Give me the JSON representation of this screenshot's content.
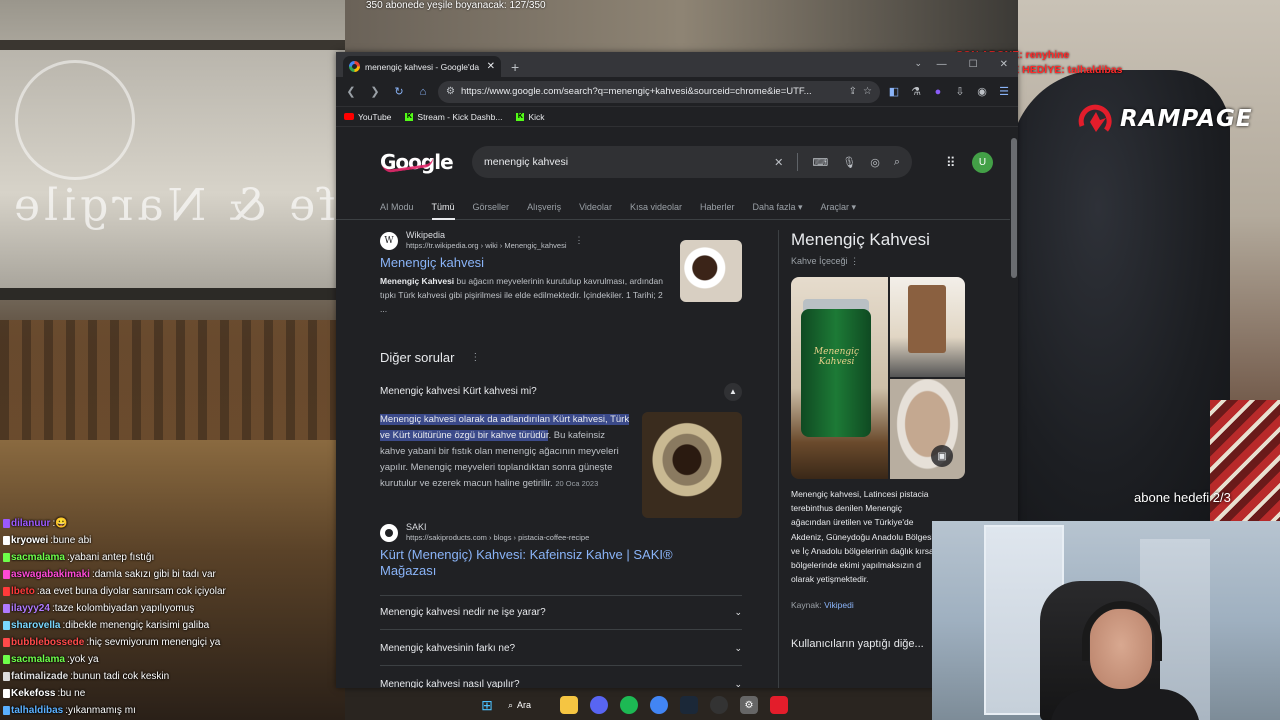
{
  "stream": {
    "sub_goal": "350 abonede yeşile boyanacak: 127/350",
    "last_sub_line1": "SON ABONE: renyhine",
    "last_sub_line2": "SON ABONE HEDİYE: talhaldibas",
    "sponsor": "RAMPAGE",
    "abone_goal": "abone hedefi 2/3"
  },
  "chat": [
    {
      "user": "dilanuur",
      "msg": "😀",
      "color": "#9b59ff"
    },
    {
      "user": "kryowei",
      "msg": "bune abi",
      "color": "#ffffff"
    },
    {
      "user": "sacmalama",
      "msg": "yabani antep fıstığı",
      "color": "#6eff4a"
    },
    {
      "user": "aswagabakimaki",
      "msg": "damla sakızı gibi bi tadı var",
      "color": "#ff4ad6"
    },
    {
      "user": "lbeto",
      "msg": "aa evet buna diyolar sanırsam cok içiyolar",
      "color": "#ff3a3a"
    },
    {
      "user": "ilayyy24",
      "msg": "taze kolombiyadan yapılıyomuş",
      "color": "#b07aff"
    },
    {
      "user": "sharovella",
      "msg": "dibekle menengiç karisimi galiba",
      "color": "#7ad8ff"
    },
    {
      "user": "bubblebossede",
      "msg": "hiç sevmiyorum menengiçi ya",
      "color": "#ff4a4a"
    },
    {
      "user": "sacmalama",
      "msg": "yok ya",
      "color": "#6eff4a"
    },
    {
      "user": "fatimalizade",
      "msg": "bunun tadi cok keskin",
      "color": "#dddddd"
    },
    {
      "user": "Kekefoss",
      "msg": "bu ne",
      "color": "#ffffff"
    },
    {
      "user": "talhaldibas",
      "msg": "yıkanmamış mı",
      "color": "#5ab0ff"
    }
  ],
  "browser": {
    "tab_title": "menengiç kahvesi - Google'da",
    "url": "https://www.google.com/search?q=menengiç+kahvesi&sourceid=chrome&ie=UTF...",
    "bookmarks": [
      {
        "label": "YouTube"
      },
      {
        "label": "Stream - Kick Dashb..."
      },
      {
        "label": "Kick"
      }
    ]
  },
  "google": {
    "logo": "Google",
    "query": "menengiç kahvesi",
    "tabs": [
      "AI Modu",
      "Tümü",
      "Görseller",
      "Alışveriş",
      "Videolar",
      "Kısa videolar",
      "Haberler",
      "Daha fazla ▾",
      "Araçlar ▾"
    ],
    "active_tab": "Tümü",
    "result1": {
      "site": "Wikipedia",
      "url": "https://tr.wikipedia.org › wiki › Menengiç_kahvesi",
      "title": "Menengiç kahvesi",
      "snippet_bold": "Menengiç Kahvesi",
      "snippet": " bu ağacın meyvelerinin kurutulup kavrulması, ardından tıpkı Türk kahvesi gibi pişirilmesi ile elde edilmektedir. İçindekiler. 1 Tarihi; 2 ..."
    },
    "paa_title": "Diğer sorular",
    "paa_q1": "Menengiç kahvesi Kürt kahvesi mi?",
    "paa_answer_hl": "Menengiç kahvesi olarak da adlandırılan Kürt kahvesi, Türk ve Kürt kültürüne özgü bir kahve türüdür",
    "paa_answer": ". Bu kafeinsiz kahve yabani bir fıstık olan menengiç ağacının meyveleri yapılır. Menengiç meyveleri toplandıktan sonra güneşte kurutulur ve ezerek macun haline getirilir.",
    "paa_date": "20 Oca 2023",
    "saki": {
      "site": "SAKI",
      "url": "https://sakiproducts.com › blogs › pistacia-coffee-recipe",
      "title": "Kürt (Menengiç) Kahvesi: Kafeinsiz Kahve | SAKI® Mağazası"
    },
    "paa_more": [
      "Menengiç kahvesi nedir ne işe yarar?",
      "Menengiç kahvesinin farkı ne?",
      "Menengiç kahvesi nasıl yapılır?"
    ],
    "kp": {
      "title": "Menengiç Kahvesi",
      "subtitle": "Kahve İçeceği",
      "jar_label": "Menengiç Kahvesi",
      "description": "Menengiç kahvesi, Latincesi pistacia terebinthus denilen Menengiç ağacından üretilen ve Türkiye'de Akdeniz, Güneydoğu Anadolu Bölgesi ve İç Anadolu bölgelerinin dağlık kırsal bölgelerinde ekimi yapılmaksızın d olarak yetişmektedir.",
      "source_label": "Kaynak:",
      "source_link": "Vikipedi",
      "more": "Kullanıcıların yaptığı diğe..."
    },
    "avatar": "U"
  },
  "taskbar": {
    "search_label": "Ara"
  }
}
